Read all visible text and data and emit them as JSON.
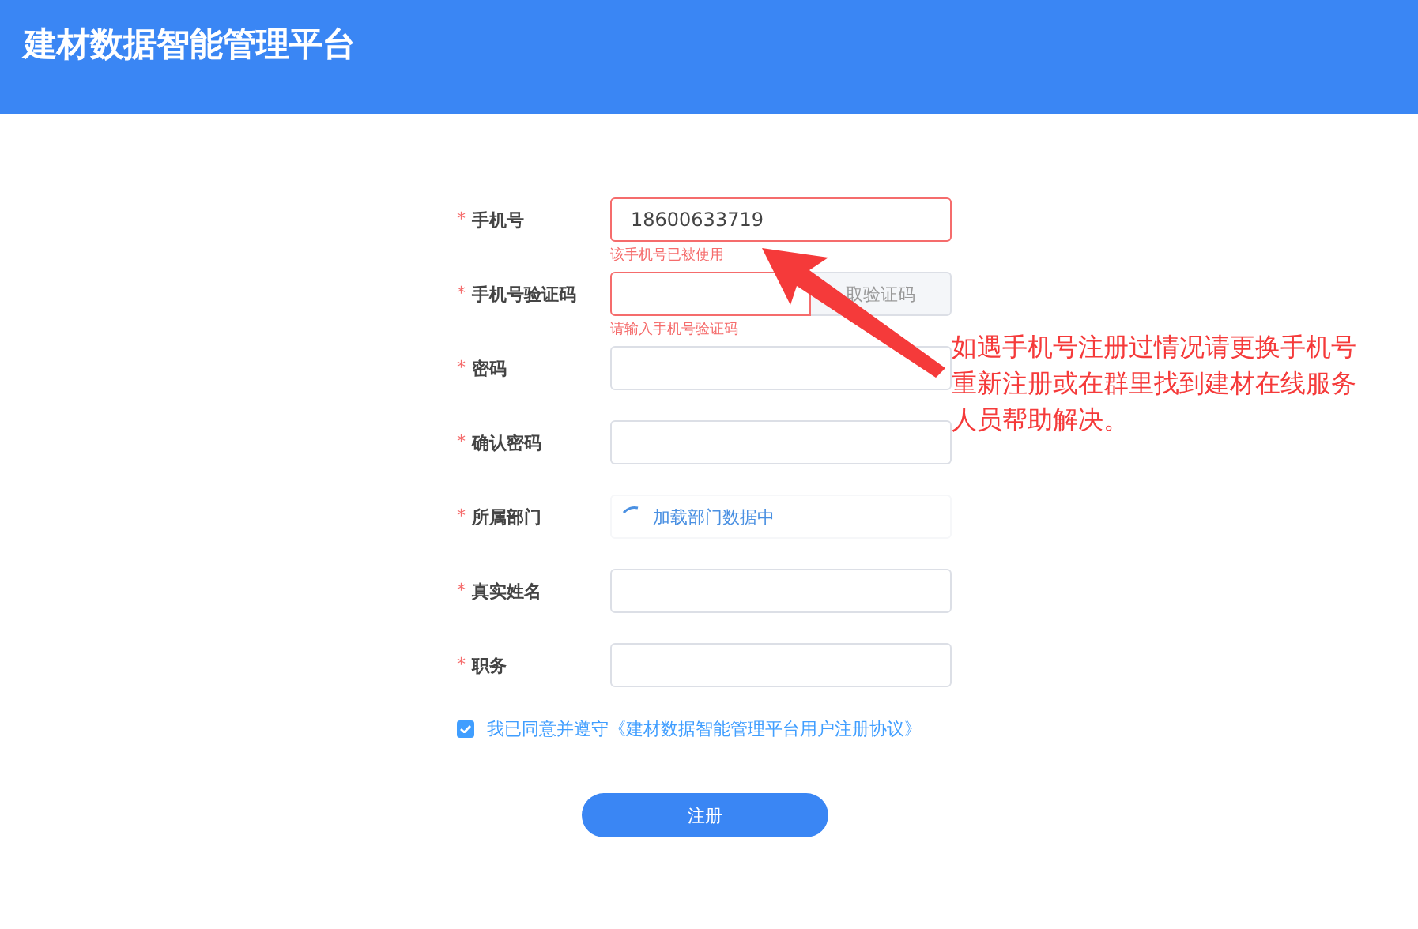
{
  "header": {
    "title": "建材数据智能管理平台"
  },
  "fields": [
    {
      "kind": "input",
      "required_mark": "*",
      "label": "手机号",
      "value": "18600633719",
      "error": "该手机号已被使用"
    },
    {
      "kind": "code",
      "required_mark": "*",
      "label": "手机号验证码",
      "button": "取验证码",
      "error": "请输入手机号验证码"
    },
    {
      "kind": "input",
      "required_mark": "*",
      "label": "密码"
    },
    {
      "kind": "input",
      "required_mark": "*",
      "label": "确认密码"
    },
    {
      "kind": "loading",
      "required_mark": "*",
      "label": "所属部门",
      "loading_text": "加载部门数据中"
    },
    {
      "kind": "input",
      "required_mark": "*",
      "label": "真实姓名"
    },
    {
      "kind": "input",
      "required_mark": "*",
      "label": "职务"
    }
  ],
  "agreement": {
    "checked": true,
    "text": "我已同意并遵守《建材数据智能管理平台用户注册协议》"
  },
  "submit": "注册",
  "annotation": "如遇手机号注册过情况请更换手机号重新注册或在群里找到建材在线服务人员帮助解决。"
}
